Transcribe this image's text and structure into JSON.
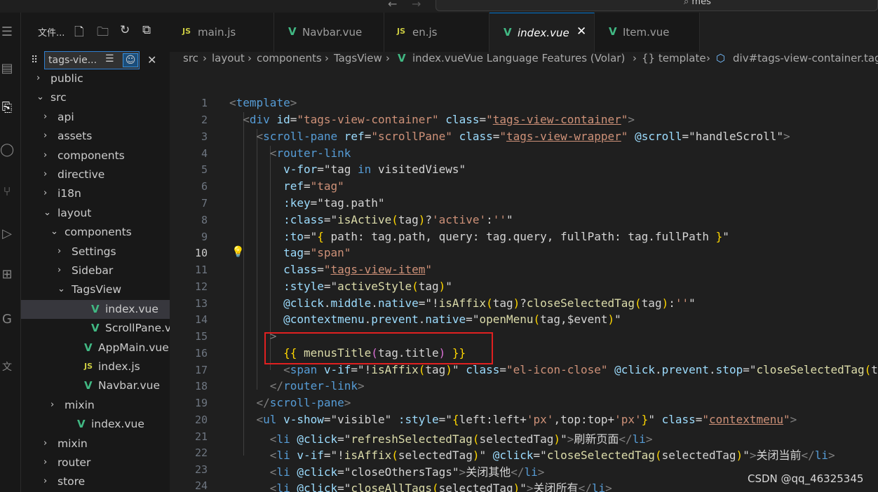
{
  "titlebar": {
    "search_text": "mes"
  },
  "sidebar": {
    "header": "文件...",
    "filter_value": "tags-vie...",
    "tree": [
      {
        "label": "public",
        "type": "folder",
        "open": false
      },
      {
        "label": "src",
        "type": "folder",
        "open": true
      },
      {
        "label": "api",
        "type": "folder",
        "open": false
      },
      {
        "label": "assets",
        "type": "folder",
        "open": false
      },
      {
        "label": "components",
        "type": "folder",
        "open": false
      },
      {
        "label": "directive",
        "type": "folder",
        "open": false
      },
      {
        "label": "i18n",
        "type": "folder",
        "open": false
      },
      {
        "label": "layout",
        "type": "folder",
        "open": true
      },
      {
        "label": "components",
        "type": "folder",
        "open": true
      },
      {
        "label": "Settings",
        "type": "folder",
        "open": false
      },
      {
        "label": "Sidebar",
        "type": "folder",
        "open": false
      },
      {
        "label": "TagsView",
        "type": "folder",
        "open": true
      },
      {
        "label": "index.vue",
        "type": "vue",
        "selected": true
      },
      {
        "label": "ScrollPane.vue",
        "type": "vue"
      },
      {
        "label": "AppMain.vue",
        "type": "vue"
      },
      {
        "label": "index.js",
        "type": "js"
      },
      {
        "label": "Navbar.vue",
        "type": "vue"
      },
      {
        "label": "mixin",
        "type": "folder",
        "open": false
      },
      {
        "label": "index.vue",
        "type": "vue"
      },
      {
        "label": "mixin",
        "type": "folder",
        "open": false
      },
      {
        "label": "router",
        "type": "folder",
        "open": false
      },
      {
        "label": "store",
        "type": "folder",
        "open": false
      }
    ]
  },
  "tabs": [
    {
      "label": "main.js",
      "type": "js",
      "active": false
    },
    {
      "label": "Navbar.vue",
      "type": "vue",
      "active": false
    },
    {
      "label": "en.js",
      "type": "js",
      "active": false
    },
    {
      "label": "index.vue",
      "type": "vue",
      "active": true
    },
    {
      "label": "Item.vue",
      "type": "vue",
      "active": false
    }
  ],
  "breadcrumb": [
    "src",
    "layout",
    "components",
    "TagsView",
    "index.vue",
    "Vue Language Features (Volar)",
    "{} template",
    "div#tags-view-container.tags"
  ],
  "editor": {
    "current_line": 10,
    "line_numbers": [
      "1",
      "2",
      "3",
      "4",
      "5",
      "6",
      "7",
      "8",
      "9",
      "10",
      "11",
      "12",
      "13",
      "14",
      "15",
      "16",
      "17",
      "18",
      "19",
      "20",
      "21",
      "22",
      "23",
      "24"
    ]
  },
  "watermark": "CSDN @qq_46325345",
  "colors": {
    "accent": "#0078d4",
    "highlight_box": "#e02020",
    "vue_icon": "#41b883",
    "js_icon": "#cbcb41"
  }
}
